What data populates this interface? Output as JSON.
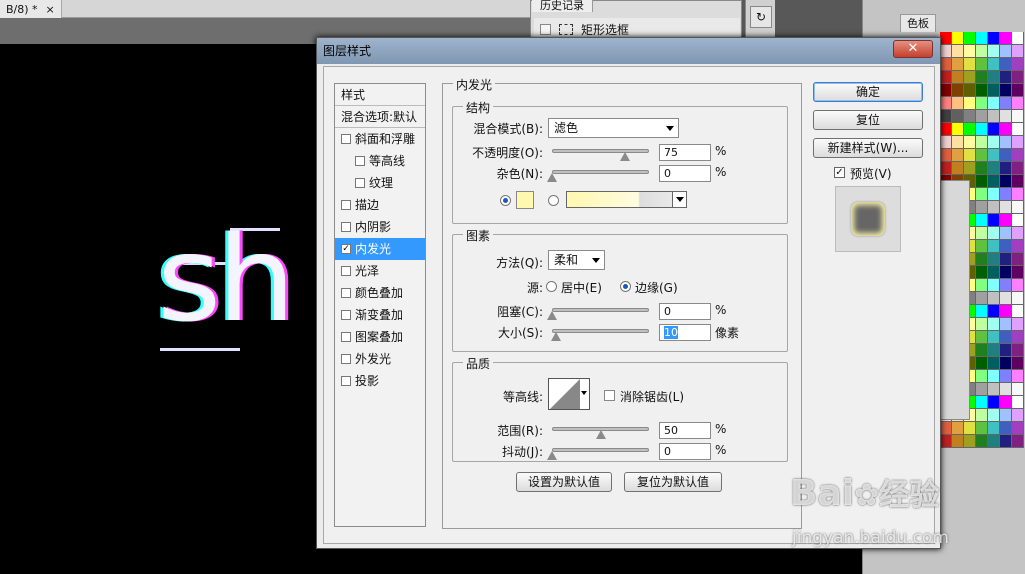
{
  "doc_tab": {
    "title": "B/8) *",
    "close": "×"
  },
  "canvas_text": "sh",
  "history": {
    "tab_label": "历史记录",
    "row_label": "矩形选框"
  },
  "right_panel": {
    "swatches_tab": "色板",
    "colors": [
      "#ff0000",
      "#ffff00",
      "#00ff00",
      "#00ffff",
      "#0000ff",
      "#ff00ff",
      "#ffffff",
      "#f0d0d0",
      "#ffe0a0",
      "#fffca0",
      "#c0ffa0",
      "#a0fff0",
      "#a0c0ff",
      "#e0a0ff",
      "#e06040",
      "#e0a040",
      "#e0e040",
      "#60c040",
      "#40c0c0",
      "#4060c0",
      "#a040c0",
      "#c02020",
      "#c08020",
      "#a0a020",
      "#208020",
      "#208080",
      "#202080",
      "#802080",
      "#800000",
      "#804000",
      "#606000",
      "#006000",
      "#006060",
      "#000060",
      "#600060",
      "#ff8080",
      "#ffc080",
      "#ffff80",
      "#80ff80",
      "#80ffff",
      "#8080ff",
      "#ff80ff",
      "#404040",
      "#606060",
      "#808080",
      "#a0a0a0",
      "#c0c0c0",
      "#e0e0e0",
      "#f8f8f8"
    ]
  },
  "dialog": {
    "title": "图层样式",
    "close": "✕",
    "styles_header": "样式",
    "blend_options": "混合选项:默认",
    "style_items": [
      {
        "label": "斜面和浮雕",
        "checked": false,
        "indent": false
      },
      {
        "label": "等高线",
        "checked": false,
        "indent": true
      },
      {
        "label": "纹理",
        "checked": false,
        "indent": true
      },
      {
        "label": "描边",
        "checked": false,
        "indent": false
      },
      {
        "label": "内阴影",
        "checked": false,
        "indent": false
      },
      {
        "label": "内发光",
        "checked": true,
        "indent": false,
        "selected": true
      },
      {
        "label": "光泽",
        "checked": false,
        "indent": false
      },
      {
        "label": "颜色叠加",
        "checked": false,
        "indent": false
      },
      {
        "label": "渐变叠加",
        "checked": false,
        "indent": false
      },
      {
        "label": "图案叠加",
        "checked": false,
        "indent": false
      },
      {
        "label": "外发光",
        "checked": false,
        "indent": false
      },
      {
        "label": "投影",
        "checked": false,
        "indent": false
      }
    ],
    "section_title": "内发光",
    "structure": {
      "title": "结构",
      "blend_mode_label": "混合模式(B):",
      "blend_mode_value": "滤色",
      "opacity_label": "不透明度(O):",
      "opacity_value": "75",
      "opacity_fraction": 0.75,
      "noise_label": "杂色(N):",
      "noise_value": "0",
      "noise_fraction": 0,
      "percent": "%",
      "glow_color": "#fff8b0"
    },
    "elements": {
      "title": "图素",
      "technique_label": "方法(Q):",
      "technique_value": "柔和",
      "source_label": "源:",
      "source_center": "居中(E)",
      "source_edge": "边缘(G)",
      "choke_label": "阻塞(C):",
      "choke_value": "0",
      "choke_fraction": 0,
      "size_label": "大小(S):",
      "size_value": "10",
      "size_fraction": 0.04,
      "size_unit": "像素"
    },
    "quality": {
      "title": "品质",
      "contour_label": "等高线:",
      "antialias_label": "消除锯齿(L)",
      "range_label": "范围(R):",
      "range_value": "50",
      "range_fraction": 0.5,
      "jitter_label": "抖动(J):",
      "jitter_value": "0",
      "jitter_fraction": 0
    },
    "make_default": "设置为默认值",
    "reset_default": "复位为默认值",
    "buttons": {
      "ok": "确定",
      "reset": "复位",
      "new_style": "新建样式(W)...",
      "preview": "预览(V)"
    }
  },
  "watermark": {
    "text": "Bai",
    "text2": "经验",
    "url": "jingyan.baidu.com"
  }
}
